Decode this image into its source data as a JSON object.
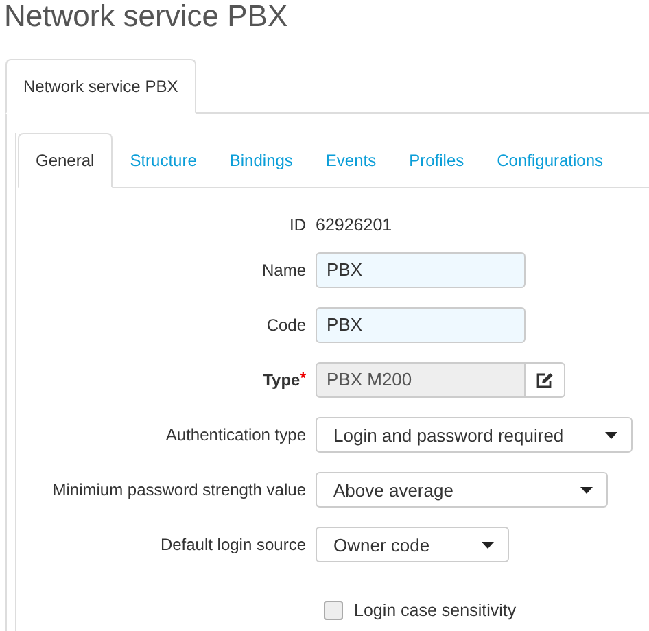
{
  "page_title": "Network service PBX",
  "outer_tabs": [
    {
      "label": "Network service PBX",
      "selected": true
    }
  ],
  "inner_tabs": [
    {
      "label": "General",
      "selected": true
    },
    {
      "label": "Structure",
      "selected": false
    },
    {
      "label": "Bindings",
      "selected": false
    },
    {
      "label": "Events",
      "selected": false
    },
    {
      "label": "Profiles",
      "selected": false
    },
    {
      "label": "Configurations",
      "selected": false
    }
  ],
  "fields": [
    {
      "kind": "static",
      "label": "ID",
      "value": "62926201"
    },
    {
      "kind": "text",
      "label": "Name",
      "value": "PBX"
    },
    {
      "kind": "text",
      "label": "Code",
      "value": "PBX"
    },
    {
      "kind": "readonly",
      "label": "Type",
      "required_mark": "*",
      "value": "PBX M200"
    },
    {
      "kind": "select",
      "label": "Authentication type",
      "value": "Login and password required"
    },
    {
      "kind": "select",
      "label": "Minimium password strength value",
      "value": "Above average"
    },
    {
      "kind": "select",
      "label": "Default login source",
      "value": "Owner code"
    }
  ],
  "checkboxes": [
    {
      "label": "Login case sensitivity",
      "checked": false
    }
  ]
}
